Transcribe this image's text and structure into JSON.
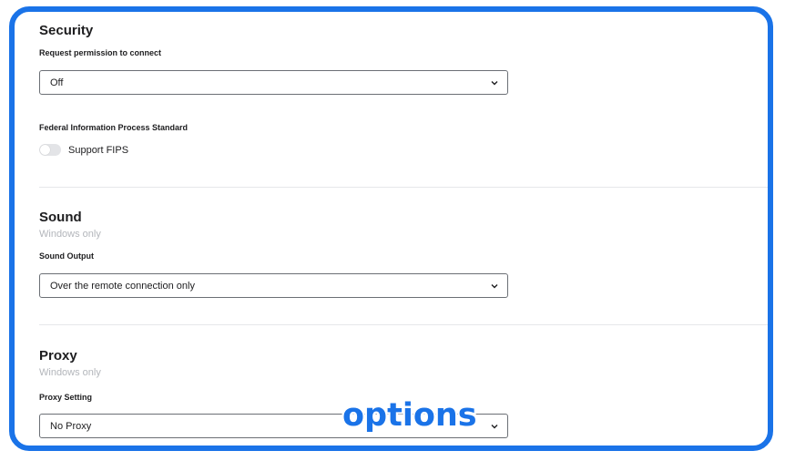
{
  "security": {
    "title": "Security",
    "request_permission": {
      "label": "Request permission to connect",
      "value": "Off"
    },
    "fips": {
      "label": "Federal Information Process Standard",
      "toggle_label": "Support FIPS",
      "enabled": false
    }
  },
  "sound": {
    "title": "Sound",
    "subtitle": "Windows only",
    "output": {
      "label": "Sound Output",
      "value": "Over the remote connection only"
    }
  },
  "proxy": {
    "title": "Proxy",
    "subtitle": "Windows only",
    "setting": {
      "label": "Proxy Setting",
      "value": "No Proxy"
    }
  },
  "overlay_caption": "options",
  "colors": {
    "frame_border": "#1a73e8",
    "caption": "#1a73e8",
    "subtitle": "#b3b6bb",
    "divider": "#e6e7ea"
  }
}
